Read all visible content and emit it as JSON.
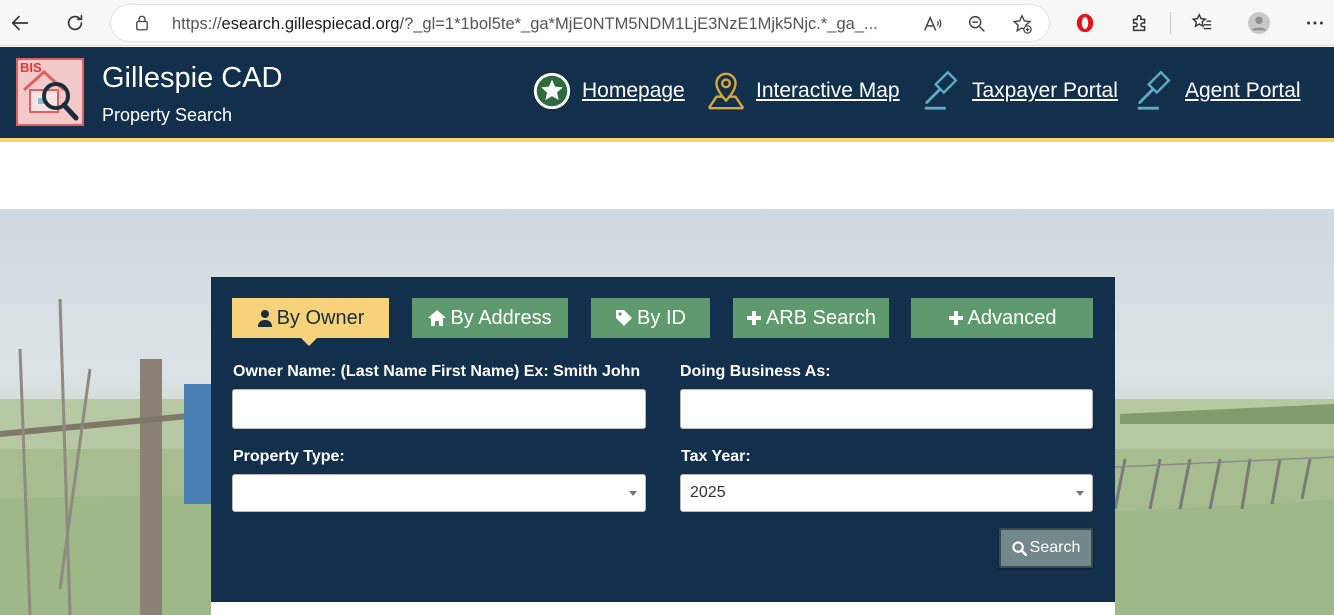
{
  "browser": {
    "url_prefix": "https://",
    "url_host": "esearch.gillespiecad.org",
    "url_rest": "/?_gl=1*1bol5te*_ga*MjE0NTM5NDM1LjE3NzE1Mjk5Njc.*_ga_..."
  },
  "header": {
    "title": "Gillespie CAD",
    "subtitle": "Property Search",
    "logo_text": "BIS",
    "nav": [
      {
        "label": "Homepage"
      },
      {
        "label": "Interactive Map"
      },
      {
        "label": "Taxpayer Portal"
      },
      {
        "label": "Agent Portal"
      }
    ]
  },
  "tabs": [
    {
      "label": "By Owner",
      "icon": "user-icon",
      "active": true
    },
    {
      "label": "By Address",
      "icon": "home-icon",
      "active": false
    },
    {
      "label": "By ID",
      "icon": "tag-icon",
      "active": false
    },
    {
      "label": "ARB Search",
      "icon": "plus-icon",
      "active": false
    },
    {
      "label": "Advanced",
      "icon": "plus-icon",
      "active": false
    }
  ],
  "form": {
    "owner_name_label": "Owner Name: (Last Name First Name) Ex: Smith John",
    "owner_name_value": "",
    "dba_label": "Doing Business As:",
    "dba_value": "",
    "property_type_label": "Property Type:",
    "property_type_value": "",
    "tax_year_label": "Tax Year:",
    "tax_year_value": "2025",
    "search_label": "Search"
  },
  "colors": {
    "header_bg": "#12304b",
    "accent_gold": "#f6d27a",
    "tab_green": "#5e9a6e",
    "search_button": "#73888a"
  }
}
